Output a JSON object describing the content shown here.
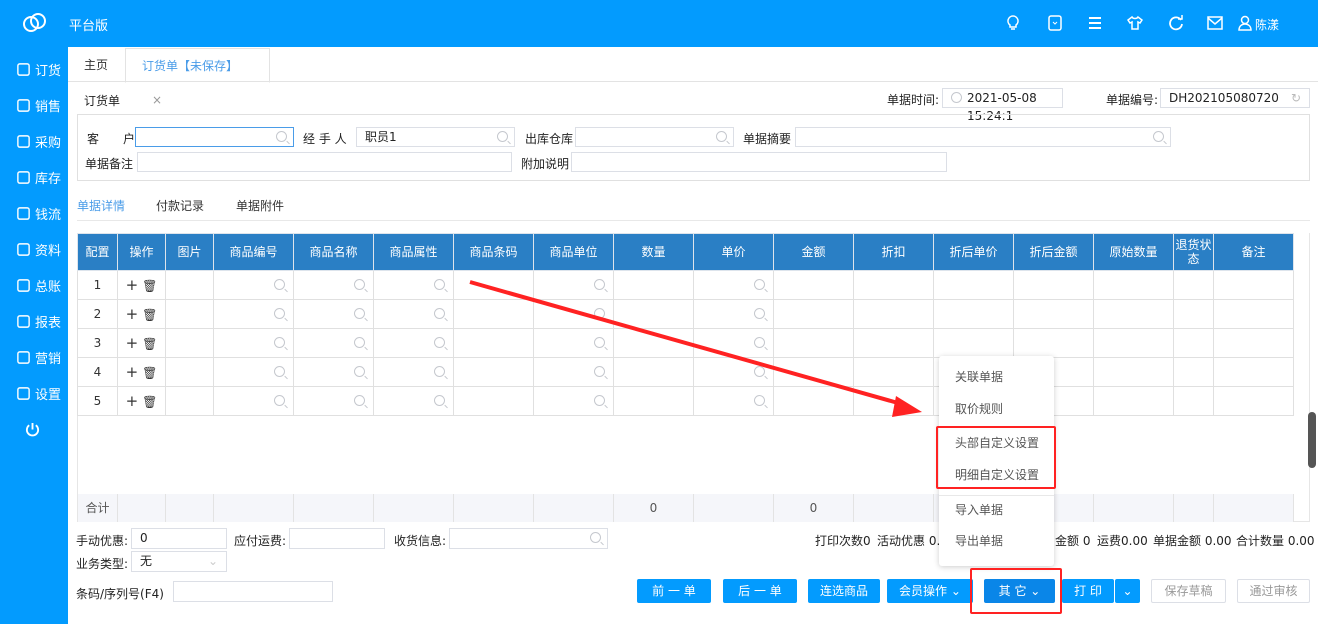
{
  "app": {
    "title": "平台版",
    "user": "陈漾",
    "icons": [
      "lightbulb-icon",
      "tablet-icon",
      "menu-icon",
      "shirt-icon",
      "refresh-icon",
      "mail-icon",
      "user-icon"
    ]
  },
  "sidebar": {
    "items": [
      {
        "label": "订货",
        "icon": "clipboard-icon"
      },
      {
        "label": "销售",
        "icon": "person-icon"
      },
      {
        "label": "采购",
        "icon": "cart-icon"
      },
      {
        "label": "库存",
        "icon": "box-icon"
      },
      {
        "label": "钱流",
        "icon": "cash-icon"
      },
      {
        "label": "资料",
        "icon": "contacts-icon"
      },
      {
        "label": "总账",
        "icon": "chart-icon"
      },
      {
        "label": "报表",
        "icon": "report-icon"
      },
      {
        "label": "营销",
        "icon": "marketing-icon"
      },
      {
        "label": "设置",
        "icon": "gear-icon"
      }
    ],
    "power": "power-icon"
  },
  "tabs": [
    {
      "label": "主页"
    },
    {
      "label": "订货单【未保存】",
      "close": "×"
    }
  ],
  "form": {
    "title": "订货单",
    "time_label": "单据时间:",
    "time_value": "2021-05-08 15:24:1",
    "no_label": "单据编号:",
    "no_value": "DH202105080720",
    "customer_label": "客　　户",
    "customer_value": "",
    "handler_label": "经 手 人",
    "handler_value": "职员1",
    "warehouse_label": "出库仓库",
    "summary_label": "单据摘要",
    "remark_label": "单据备注",
    "extra_label": "附加说明"
  },
  "subtabs": [
    "单据详情",
    "付款记录",
    "单据附件"
  ],
  "table": {
    "headers": [
      "配置",
      "操作",
      "图片",
      "商品编号",
      "商品名称",
      "商品属性",
      "商品条码",
      "商品单位",
      "数量",
      "单价",
      "金额",
      "折扣",
      "折后单价",
      "折后金额",
      "原始数量",
      "退货状态",
      "备注"
    ],
    "rows": [
      "1",
      "2",
      "3",
      "4",
      "5"
    ],
    "total_label": "合计",
    "total_qty": "0",
    "total_amount": "0"
  },
  "footer": {
    "discount_label": "手动优惠:",
    "discount_value": "0",
    "freight_label": "应付运费:",
    "receive_label": "收货信息:",
    "biz_label": "业务类型:",
    "biz_value": "无",
    "barcode_label": "条码/序列号(F4)",
    "stats": [
      "打印次数0",
      "活动优惠 0.",
      "金额 0",
      "运费0.00",
      "单据金额 0.00",
      "合计数量 0.00"
    ]
  },
  "buttons": {
    "prev": "前 一 单",
    "next": "后 一 单",
    "multi": "连选商品",
    "member": "会员操作",
    "other": "其 它",
    "print": "打 印",
    "draft": "保存草稿",
    "approve": "通过审核"
  },
  "dropdown": [
    "关联单据",
    "取价规则",
    "头部自定义设置",
    "明细自定义设置",
    "导入单据",
    "导出单据"
  ],
  "colors": {
    "brand": "#039BFE",
    "header": "#2A7FC5",
    "highlight": "#FF2222"
  }
}
